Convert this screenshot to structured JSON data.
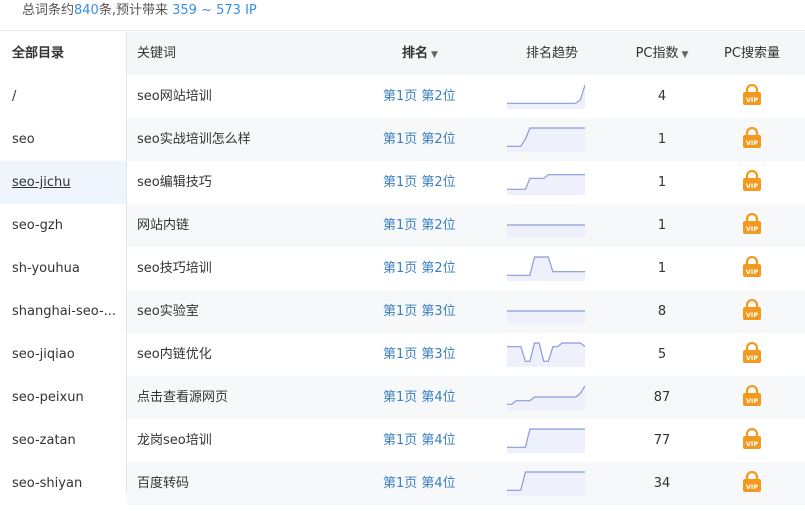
{
  "summary": {
    "prefix": "总词条约",
    "count": "840",
    "middle": "条,预计带来",
    "ip_low": "359",
    "tilde": " ~ ",
    "ip_high": "573 IP"
  },
  "sidebar": {
    "title": "全部目录",
    "items": [
      {
        "label": "/"
      },
      {
        "label": "seo"
      },
      {
        "label": "seo-jichu"
      },
      {
        "label": "seo-gzh"
      },
      {
        "label": "sh-youhua"
      },
      {
        "label": "shanghai-seo-..."
      },
      {
        "label": "seo-jiqiao"
      },
      {
        "label": "seo-peixun"
      },
      {
        "label": "seo-zatan"
      },
      {
        "label": "seo-shiyan"
      }
    ]
  },
  "table": {
    "headers": {
      "keyword": "关键词",
      "rank": "排名",
      "trend": "排名趋势",
      "pc_index": "PC指数",
      "pc_volume": "PC搜索量"
    },
    "rows": [
      {
        "keyword": "seo网站培训",
        "rank": "第1页 第2位",
        "pc_index": "4",
        "trend": [
          1,
          1,
          1,
          1,
          1,
          1,
          1,
          1,
          1,
          1,
          1,
          1,
          1,
          1,
          1,
          1,
          2,
          6
        ]
      },
      {
        "keyword": "seo实战培训怎么样",
        "rank": "第1页 第2位",
        "pc_index": "1",
        "trend": [
          1,
          1,
          1,
          1,
          3,
          6,
          6,
          6,
          6,
          6,
          6,
          6,
          6,
          6,
          6,
          6,
          6,
          6
        ]
      },
      {
        "keyword": "seo编辑技巧",
        "rank": "第1页 第2位",
        "pc_index": "1",
        "trend": [
          1,
          1,
          1,
          1,
          1,
          4,
          4,
          4,
          4,
          5,
          5,
          5,
          5,
          5,
          5,
          5,
          5,
          5
        ]
      },
      {
        "keyword": "网站内链",
        "rank": "第1页 第2位",
        "pc_index": "1",
        "trend": [
          3,
          3,
          3,
          3,
          3,
          3,
          3,
          3,
          3,
          3,
          3,
          3,
          3,
          3,
          3,
          3,
          3,
          3
        ]
      },
      {
        "keyword": "seo技巧培训",
        "rank": "第1页 第2位",
        "pc_index": "1",
        "trend": [
          1,
          1,
          1,
          1,
          1,
          1,
          6,
          6,
          6,
          6,
          2,
          2,
          2,
          2,
          2,
          2,
          2,
          2
        ]
      },
      {
        "keyword": "seo实验室",
        "rank": "第1页 第3位",
        "pc_index": "8",
        "trend": [
          3,
          3,
          3,
          3,
          3,
          3,
          3,
          3,
          3,
          3,
          3,
          3,
          3,
          3,
          3,
          3,
          3,
          3
        ]
      },
      {
        "keyword": "seo内链优化",
        "rank": "第1页 第3位",
        "pc_index": "5",
        "trend": [
          5,
          5,
          5,
          5,
          1,
          1,
          6,
          6,
          1,
          1,
          5,
          5,
          6,
          6,
          6,
          6,
          6,
          5
        ]
      },
      {
        "keyword": "点击查看源网页",
        "rank": "第1页 第4位",
        "pc_index": "87",
        "trend": [
          1,
          1,
          2,
          2,
          2,
          2,
          3,
          3,
          3,
          3,
          3,
          3,
          3,
          3,
          3,
          3,
          4,
          6
        ]
      },
      {
        "keyword": "龙岗seo培训",
        "rank": "第1页 第4位",
        "pc_index": "77",
        "trend": [
          1,
          1,
          1,
          1,
          1,
          6,
          6,
          6,
          6,
          6,
          6,
          6,
          6,
          6,
          6,
          6,
          6,
          6
        ]
      },
      {
        "keyword": "百度转码",
        "rank": "第1页 第4位",
        "pc_index": "34",
        "trend": [
          1,
          1,
          1,
          1,
          6,
          6,
          6,
          6,
          6,
          6,
          6,
          6,
          6,
          6,
          6,
          6,
          6,
          6
        ]
      }
    ]
  },
  "colors": {
    "accent": "#3a8ee6",
    "rank_link": "#3a7fc1",
    "trend_line": "#8a9ad8",
    "trend_fill": "#eef0fb",
    "vip_orange": "#f39a1e"
  },
  "icons": {
    "sort": "caret-down-icon",
    "vip": "vip-lock-icon"
  }
}
